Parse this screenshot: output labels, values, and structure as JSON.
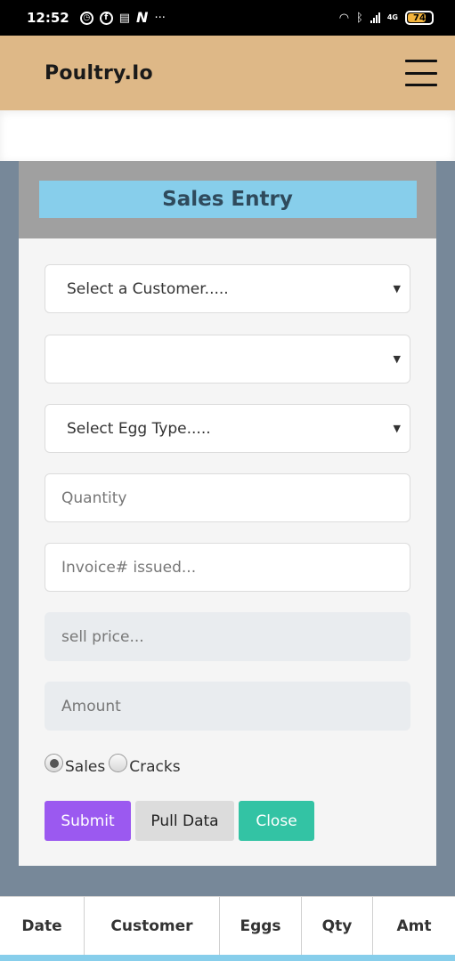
{
  "status_bar": {
    "time": "12:52",
    "network": "4G",
    "battery": "74"
  },
  "header": {
    "brand": "Poultry.Io"
  },
  "modal": {
    "title": "Sales Entry",
    "customer_select": "Select a Customer.....",
    "second_select": "",
    "egg_type_select": "Select Egg Type.....",
    "quantity_placeholder": "Quantity",
    "invoice_placeholder": "Invoice# issued...",
    "sell_price_placeholder": "sell price...",
    "amount_placeholder": "Amount",
    "radio_options": [
      "Sales",
      "Cracks"
    ],
    "selected_radio": "Sales",
    "buttons": {
      "submit": "Submit",
      "pull_data": "Pull Data",
      "close": "Close"
    }
  },
  "table": {
    "columns": [
      "Date",
      "Customer",
      "Eggs",
      "Qty",
      "Amt"
    ]
  },
  "colors": {
    "header_bg": "#deb887",
    "overlay_bg": "#778899",
    "title_bg": "#87ceeb",
    "submit": "#9b59f0",
    "close": "#33c3a4"
  }
}
